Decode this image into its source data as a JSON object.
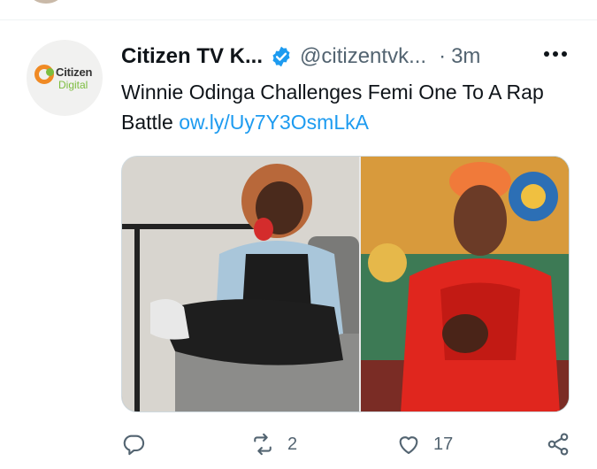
{
  "tweet": {
    "display_name": "Citizen TV K...",
    "handle": "@citizentvk...",
    "separator": "·",
    "time": "3m",
    "text": "Winnie Odinga Challenges Femi One To A Rap Battle",
    "link": "ow.ly/Uy7Y3OsmLkA",
    "avatar_logo": {
      "line1": "Citizen",
      "line2": "Digital"
    },
    "icons": {
      "verified": "verified-badge-icon",
      "more": "more-options-icon",
      "reply": "reply-icon",
      "retweet": "retweet-icon",
      "like": "like-icon",
      "share": "share-icon"
    },
    "actions": {
      "retweet_count": "2",
      "like_count": "17"
    }
  },
  "colors": {
    "accent": "#1d9bf0",
    "secondary_text": "#536471",
    "divider": "#eff3f4"
  }
}
